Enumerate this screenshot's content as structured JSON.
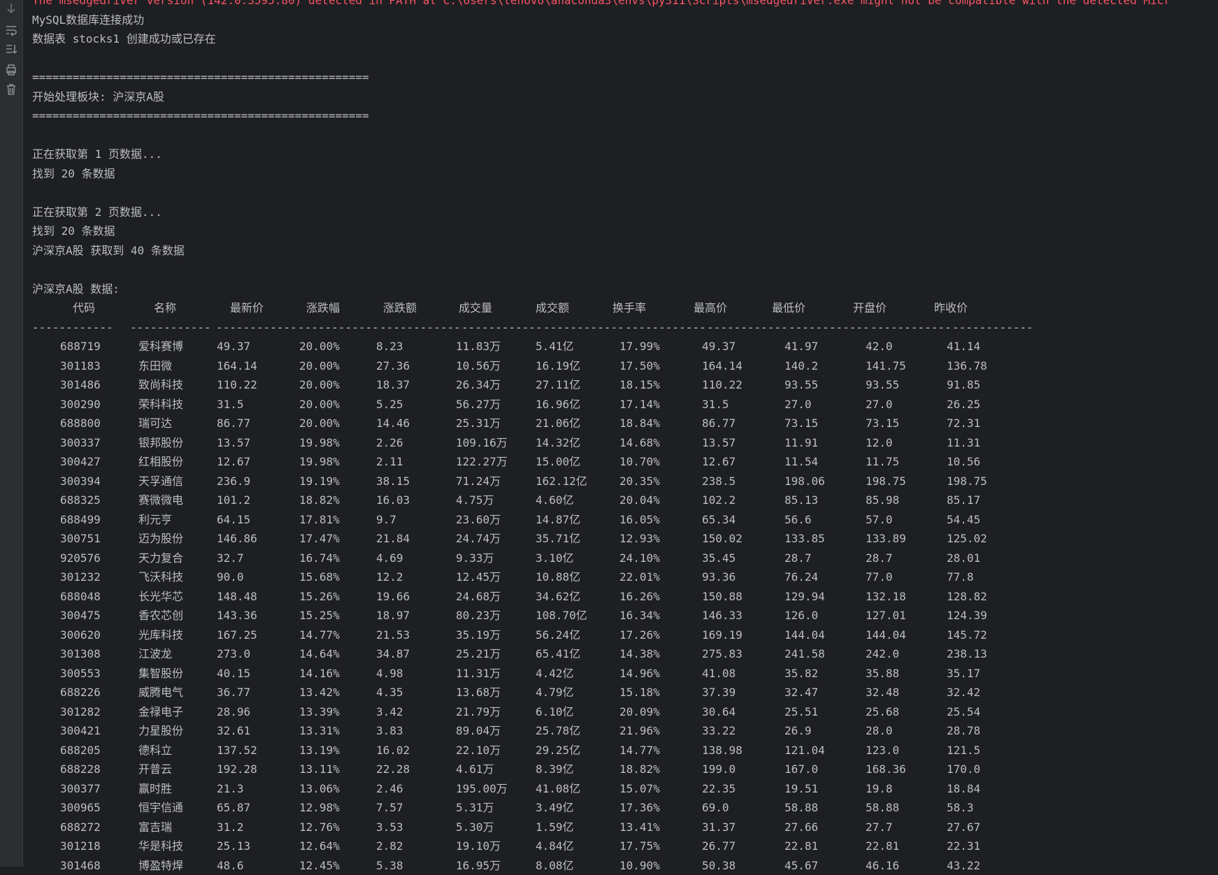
{
  "gutter_icons": [
    "arrow-down-icon",
    "soft-wrap-icon",
    "scroll-to-end-icon",
    "print-icon",
    "trash-icon"
  ],
  "colors": {
    "background": "#1e1f22",
    "text": "#bcbec4",
    "warning": "#f75464",
    "gutter": "#2b2d30"
  },
  "log": {
    "warning": "The msedgedriver version (142.0.3595.80) detected in PATH at C:\\Users\\lenovo\\anaconda3\\envs\\py311\\Scripts\\msedgedriver.exe might not be compatible with the detected Micr",
    "lines": [
      "MySQL数据库连接成功",
      "数据表 stocks1 创建成功或已存在",
      "",
      "==================================================",
      "开始处理板块: 沪深京A股",
      "==================================================",
      "",
      "正在获取第 1 页数据...",
      "找到 20 条数据",
      "",
      "正在获取第 2 页数据...",
      "找到 20 条数据",
      "沪深京A股 获取到 40 条数据",
      "",
      "沪深京A股 数据:"
    ]
  },
  "table": {
    "headers": [
      "代码",
      "名称",
      "最新价",
      "涨跌幅",
      "涨跌额",
      "成交量",
      "成交额",
      "换手率",
      "最高价",
      "最低价",
      "开盘价",
      "昨收价"
    ],
    "separator": "------------",
    "rows": [
      [
        "688719",
        "爱科赛博",
        "49.37",
        "20.00%",
        "8.23",
        "11.83万",
        "5.41亿",
        "17.99%",
        "49.37",
        "41.97",
        "42.0",
        "41.14"
      ],
      [
        "301183",
        "东田微",
        "164.14",
        "20.00%",
        "27.36",
        "10.56万",
        "16.19亿",
        "17.50%",
        "164.14",
        "140.2",
        "141.75",
        "136.78"
      ],
      [
        "301486",
        "致尚科技",
        "110.22",
        "20.00%",
        "18.37",
        "26.34万",
        "27.11亿",
        "18.15%",
        "110.22",
        "93.55",
        "93.55",
        "91.85"
      ],
      [
        "300290",
        "荣科科技",
        "31.5",
        "20.00%",
        "5.25",
        "56.27万",
        "16.96亿",
        "17.14%",
        "31.5",
        "27.0",
        "27.0",
        "26.25"
      ],
      [
        "688800",
        "瑞可达",
        "86.77",
        "20.00%",
        "14.46",
        "25.31万",
        "21.06亿",
        "18.84%",
        "86.77",
        "73.15",
        "73.15",
        "72.31"
      ],
      [
        "300337",
        "银邦股份",
        "13.57",
        "19.98%",
        "2.26",
        "109.16万",
        "14.32亿",
        "14.68%",
        "13.57",
        "11.91",
        "12.0",
        "11.31"
      ],
      [
        "300427",
        "红相股份",
        "12.67",
        "19.98%",
        "2.11",
        "122.27万",
        "15.00亿",
        "10.70%",
        "12.67",
        "11.54",
        "11.75",
        "10.56"
      ],
      [
        "300394",
        "天孚通信",
        "236.9",
        "19.19%",
        "38.15",
        "71.24万",
        "162.12亿",
        "20.35%",
        "238.5",
        "198.06",
        "198.75",
        "198.75"
      ],
      [
        "688325",
        "赛微微电",
        "101.2",
        "18.82%",
        "16.03",
        "4.75万",
        "4.60亿",
        "20.04%",
        "102.2",
        "85.13",
        "85.98",
        "85.17"
      ],
      [
        "688499",
        "利元亨",
        "64.15",
        "17.81%",
        "9.7",
        "23.60万",
        "14.87亿",
        "16.05%",
        "65.34",
        "56.6",
        "57.0",
        "54.45"
      ],
      [
        "300751",
        "迈为股份",
        "146.86",
        "17.47%",
        "21.84",
        "24.74万",
        "35.71亿",
        "12.93%",
        "150.02",
        "133.85",
        "133.89",
        "125.02"
      ],
      [
        "920576",
        "天力复合",
        "32.7",
        "16.74%",
        "4.69",
        "9.33万",
        "3.10亿",
        "24.10%",
        "35.45",
        "28.7",
        "28.7",
        "28.01"
      ],
      [
        "301232",
        "飞沃科技",
        "90.0",
        "15.68%",
        "12.2",
        "12.45万",
        "10.88亿",
        "22.01%",
        "93.36",
        "76.24",
        "77.0",
        "77.8"
      ],
      [
        "688048",
        "长光华芯",
        "148.48",
        "15.26%",
        "19.66",
        "24.68万",
        "34.62亿",
        "16.26%",
        "150.88",
        "129.94",
        "132.18",
        "128.82"
      ],
      [
        "300475",
        "香农芯创",
        "143.36",
        "15.25%",
        "18.97",
        "80.23万",
        "108.70亿",
        "16.34%",
        "146.33",
        "126.0",
        "127.01",
        "124.39"
      ],
      [
        "300620",
        "光库科技",
        "167.25",
        "14.77%",
        "21.53",
        "35.19万",
        "56.24亿",
        "17.26%",
        "169.19",
        "144.04",
        "144.04",
        "145.72"
      ],
      [
        "301308",
        "江波龙",
        "273.0",
        "14.64%",
        "34.87",
        "25.21万",
        "65.41亿",
        "14.38%",
        "275.83",
        "241.58",
        "242.0",
        "238.13"
      ],
      [
        "300553",
        "集智股份",
        "40.15",
        "14.16%",
        "4.98",
        "11.31万",
        "4.42亿",
        "14.96%",
        "41.08",
        "35.82",
        "35.88",
        "35.17"
      ],
      [
        "688226",
        "威腾电气",
        "36.77",
        "13.42%",
        "4.35",
        "13.68万",
        "4.79亿",
        "15.18%",
        "37.39",
        "32.47",
        "32.48",
        "32.42"
      ],
      [
        "301282",
        "金禄电子",
        "28.96",
        "13.39%",
        "3.42",
        "21.79万",
        "6.10亿",
        "20.09%",
        "30.64",
        "25.51",
        "25.68",
        "25.54"
      ],
      [
        "300421",
        "力星股份",
        "32.61",
        "13.31%",
        "3.83",
        "89.04万",
        "25.78亿",
        "21.96%",
        "33.22",
        "26.9",
        "28.0",
        "28.78"
      ],
      [
        "688205",
        "德科立",
        "137.52",
        "13.19%",
        "16.02",
        "22.10万",
        "29.25亿",
        "14.77%",
        "138.98",
        "121.04",
        "123.0",
        "121.5"
      ],
      [
        "688228",
        "开普云",
        "192.28",
        "13.11%",
        "22.28",
        "4.61万",
        "8.39亿",
        "18.82%",
        "199.0",
        "167.0",
        "168.36",
        "170.0"
      ],
      [
        "300377",
        "赢时胜",
        "21.3",
        "13.06%",
        "2.46",
        "195.00万",
        "41.08亿",
        "15.07%",
        "22.35",
        "19.51",
        "19.8",
        "18.84"
      ],
      [
        "300965",
        "恒宇信通",
        "65.87",
        "12.98%",
        "7.57",
        "5.31万",
        "3.49亿",
        "17.36%",
        "69.0",
        "58.88",
        "58.88",
        "58.3"
      ],
      [
        "688272",
        "富吉瑞",
        "31.2",
        "12.76%",
        "3.53",
        "5.30万",
        "1.59亿",
        "13.41%",
        "31.37",
        "27.66",
        "27.7",
        "27.67"
      ],
      [
        "301218",
        "华是科技",
        "25.13",
        "12.64%",
        "2.82",
        "19.10万",
        "4.84亿",
        "17.75%",
        "26.77",
        "22.81",
        "22.81",
        "22.31"
      ],
      [
        "301468",
        "博盈特焊",
        "48.6",
        "12.45%",
        "5.38",
        "16.95万",
        "8.08亿",
        "10.90%",
        "50.38",
        "45.67",
        "46.16",
        "43.22"
      ]
    ]
  }
}
